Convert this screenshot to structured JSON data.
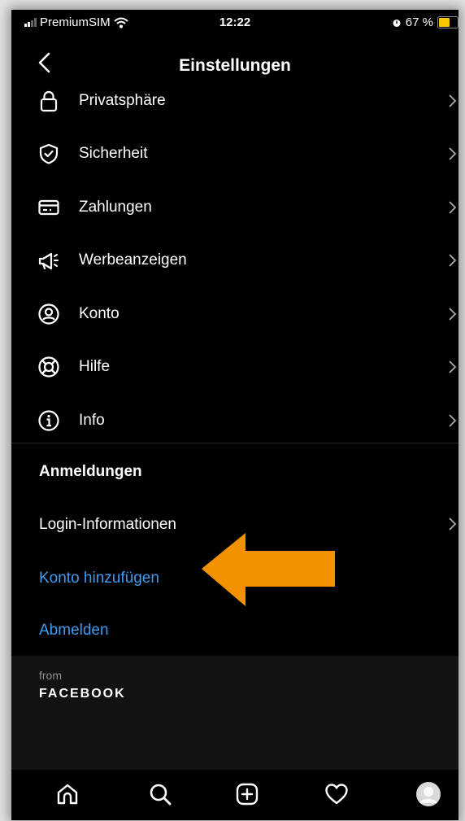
{
  "status_bar": {
    "carrier": "PremiumSIM",
    "time": "12:22",
    "battery_percent": "67 %",
    "battery_level": 0.67
  },
  "nav": {
    "title": "Einstellungen"
  },
  "menu_items": [
    {
      "label": "Privatsphäre",
      "icon": "lock-icon"
    },
    {
      "label": "Sicherheit",
      "icon": "shield-check-icon"
    },
    {
      "label": "Zahlungen",
      "icon": "credit-card-icon"
    },
    {
      "label": "Werbeanzeigen",
      "icon": "megaphone-icon"
    },
    {
      "label": "Konto",
      "icon": "account-circle-icon"
    },
    {
      "label": "Hilfe",
      "icon": "lifebuoy-icon"
    },
    {
      "label": "Info",
      "icon": "info-icon"
    }
  ],
  "logins": {
    "section_title": "Anmeldungen",
    "login_info": "Login-Informationen",
    "add_account": "Konto hinzufügen",
    "logout": "Abmelden"
  },
  "footer": {
    "from": "from",
    "brand": "FACEBOOK"
  },
  "tab_bar": {
    "tabs": [
      "home-icon",
      "search-icon",
      "new-post-icon",
      "activity-heart-icon",
      "profile-avatar"
    ]
  },
  "colors": {
    "background": "#000000",
    "link_blue": "#3f9bf2",
    "annotation_arrow": "#f39200",
    "footer_bg": "#121212"
  }
}
